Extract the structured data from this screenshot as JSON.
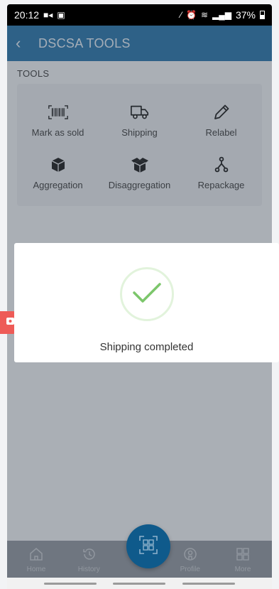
{
  "status_bar": {
    "time": "20:12",
    "battery": "37%",
    "icons": [
      "video-icon",
      "gallery-icon",
      "mute-icon",
      "alarm-icon",
      "wifi-icon",
      "signal-icon",
      "battery-icon"
    ]
  },
  "header": {
    "title": "DSCSA TOOLS",
    "back_icon": "chevron-left-icon",
    "background": "#1e6fa8"
  },
  "tools": {
    "section_label": "TOOLS",
    "items": [
      {
        "label": "Mark as sold",
        "icon": "barcode-icon"
      },
      {
        "label": "Shipping",
        "icon": "truck-icon"
      },
      {
        "label": "Relabel",
        "icon": "pencil-icon"
      },
      {
        "label": "Aggregation",
        "icon": "box-icon"
      },
      {
        "label": "Disaggregation",
        "icon": "open-box-icon"
      },
      {
        "label": "Repackage",
        "icon": "branch-icon"
      }
    ]
  },
  "dialog": {
    "message": "Shipping completed",
    "icon": "check-icon",
    "accent": "#7cc66b"
  },
  "bottom_nav": {
    "items": [
      {
        "label": "Home",
        "icon": "home-icon"
      },
      {
        "label": "History",
        "icon": "history-icon"
      },
      {
        "label": "Profile",
        "icon": "profile-icon"
      },
      {
        "label": "More",
        "icon": "grid-icon"
      }
    ],
    "fab_icon": "qr-scan-icon",
    "fab_color": "#0f5a8b"
  },
  "floating": {
    "left_icon": "record-icon",
    "right_icon": "edit-icon"
  }
}
